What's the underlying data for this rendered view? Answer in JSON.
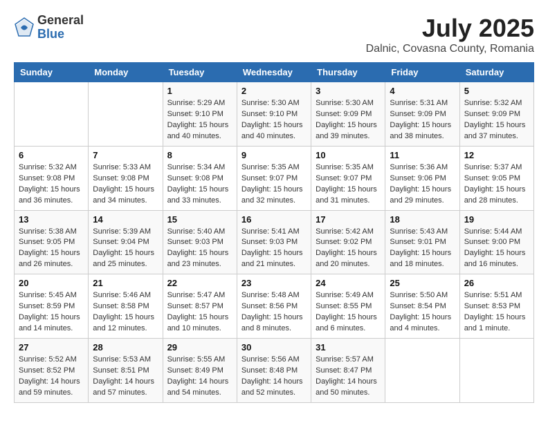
{
  "header": {
    "logo_general": "General",
    "logo_blue": "Blue",
    "title": "July 2025",
    "location": "Dalnic, Covasna County, Romania"
  },
  "days_of_week": [
    "Sunday",
    "Monday",
    "Tuesday",
    "Wednesday",
    "Thursday",
    "Friday",
    "Saturday"
  ],
  "weeks": [
    [
      {
        "day": "",
        "info": ""
      },
      {
        "day": "",
        "info": ""
      },
      {
        "day": "1",
        "info": "Sunrise: 5:29 AM\nSunset: 9:10 PM\nDaylight: 15 hours and 40 minutes."
      },
      {
        "day": "2",
        "info": "Sunrise: 5:30 AM\nSunset: 9:10 PM\nDaylight: 15 hours and 40 minutes."
      },
      {
        "day": "3",
        "info": "Sunrise: 5:30 AM\nSunset: 9:09 PM\nDaylight: 15 hours and 39 minutes."
      },
      {
        "day": "4",
        "info": "Sunrise: 5:31 AM\nSunset: 9:09 PM\nDaylight: 15 hours and 38 minutes."
      },
      {
        "day": "5",
        "info": "Sunrise: 5:32 AM\nSunset: 9:09 PM\nDaylight: 15 hours and 37 minutes."
      }
    ],
    [
      {
        "day": "6",
        "info": "Sunrise: 5:32 AM\nSunset: 9:08 PM\nDaylight: 15 hours and 36 minutes."
      },
      {
        "day": "7",
        "info": "Sunrise: 5:33 AM\nSunset: 9:08 PM\nDaylight: 15 hours and 34 minutes."
      },
      {
        "day": "8",
        "info": "Sunrise: 5:34 AM\nSunset: 9:08 PM\nDaylight: 15 hours and 33 minutes."
      },
      {
        "day": "9",
        "info": "Sunrise: 5:35 AM\nSunset: 9:07 PM\nDaylight: 15 hours and 32 minutes."
      },
      {
        "day": "10",
        "info": "Sunrise: 5:35 AM\nSunset: 9:07 PM\nDaylight: 15 hours and 31 minutes."
      },
      {
        "day": "11",
        "info": "Sunrise: 5:36 AM\nSunset: 9:06 PM\nDaylight: 15 hours and 29 minutes."
      },
      {
        "day": "12",
        "info": "Sunrise: 5:37 AM\nSunset: 9:05 PM\nDaylight: 15 hours and 28 minutes."
      }
    ],
    [
      {
        "day": "13",
        "info": "Sunrise: 5:38 AM\nSunset: 9:05 PM\nDaylight: 15 hours and 26 minutes."
      },
      {
        "day": "14",
        "info": "Sunrise: 5:39 AM\nSunset: 9:04 PM\nDaylight: 15 hours and 25 minutes."
      },
      {
        "day": "15",
        "info": "Sunrise: 5:40 AM\nSunset: 9:03 PM\nDaylight: 15 hours and 23 minutes."
      },
      {
        "day": "16",
        "info": "Sunrise: 5:41 AM\nSunset: 9:03 PM\nDaylight: 15 hours and 21 minutes."
      },
      {
        "day": "17",
        "info": "Sunrise: 5:42 AM\nSunset: 9:02 PM\nDaylight: 15 hours and 20 minutes."
      },
      {
        "day": "18",
        "info": "Sunrise: 5:43 AM\nSunset: 9:01 PM\nDaylight: 15 hours and 18 minutes."
      },
      {
        "day": "19",
        "info": "Sunrise: 5:44 AM\nSunset: 9:00 PM\nDaylight: 15 hours and 16 minutes."
      }
    ],
    [
      {
        "day": "20",
        "info": "Sunrise: 5:45 AM\nSunset: 8:59 PM\nDaylight: 15 hours and 14 minutes."
      },
      {
        "day": "21",
        "info": "Sunrise: 5:46 AM\nSunset: 8:58 PM\nDaylight: 15 hours and 12 minutes."
      },
      {
        "day": "22",
        "info": "Sunrise: 5:47 AM\nSunset: 8:57 PM\nDaylight: 15 hours and 10 minutes."
      },
      {
        "day": "23",
        "info": "Sunrise: 5:48 AM\nSunset: 8:56 PM\nDaylight: 15 hours and 8 minutes."
      },
      {
        "day": "24",
        "info": "Sunrise: 5:49 AM\nSunset: 8:55 PM\nDaylight: 15 hours and 6 minutes."
      },
      {
        "day": "25",
        "info": "Sunrise: 5:50 AM\nSunset: 8:54 PM\nDaylight: 15 hours and 4 minutes."
      },
      {
        "day": "26",
        "info": "Sunrise: 5:51 AM\nSunset: 8:53 PM\nDaylight: 15 hours and 1 minute."
      }
    ],
    [
      {
        "day": "27",
        "info": "Sunrise: 5:52 AM\nSunset: 8:52 PM\nDaylight: 14 hours and 59 minutes."
      },
      {
        "day": "28",
        "info": "Sunrise: 5:53 AM\nSunset: 8:51 PM\nDaylight: 14 hours and 57 minutes."
      },
      {
        "day": "29",
        "info": "Sunrise: 5:55 AM\nSunset: 8:49 PM\nDaylight: 14 hours and 54 minutes."
      },
      {
        "day": "30",
        "info": "Sunrise: 5:56 AM\nSunset: 8:48 PM\nDaylight: 14 hours and 52 minutes."
      },
      {
        "day": "31",
        "info": "Sunrise: 5:57 AM\nSunset: 8:47 PM\nDaylight: 14 hours and 50 minutes."
      },
      {
        "day": "",
        "info": ""
      },
      {
        "day": "",
        "info": ""
      }
    ]
  ]
}
